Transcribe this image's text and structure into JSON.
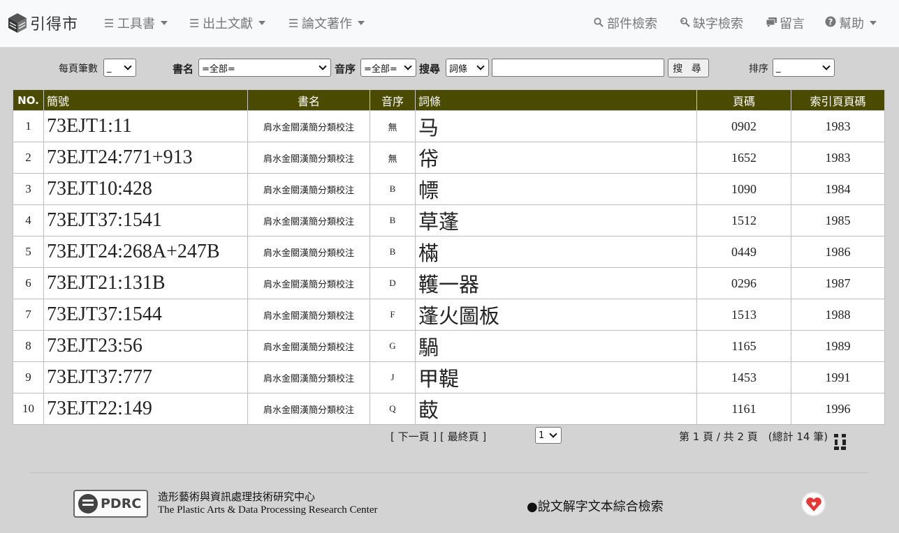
{
  "navbar": {
    "brand": "引得市",
    "menus": [
      {
        "label": "工具書"
      },
      {
        "label": "出土文獻"
      },
      {
        "label": "論文著作"
      }
    ],
    "links": [
      {
        "label": "部件檢索",
        "icon": "search-icon"
      },
      {
        "label": "缺字檢索",
        "icon": "key-search-icon"
      },
      {
        "label": "留言",
        "icon": "comment-icon"
      },
      {
        "label": "幫助",
        "icon": "help-icon"
      }
    ]
  },
  "filters": {
    "per_page_label": "每頁筆數",
    "per_page_value": "_",
    "book_label": "書名",
    "book_value": "=全部=",
    "sound_label": "音序",
    "sound_value": "=全部=",
    "search_label": "搜尋",
    "search_field_value": "詞條",
    "search_input_value": "",
    "search_button": "搜 尋",
    "sort_label": "排序",
    "sort_value": "_"
  },
  "table": {
    "headers": {
      "no": "NO.",
      "code": "簡號",
      "book": "書名",
      "sound": "音序",
      "entry": "詞條",
      "page": "頁碼",
      "index_page": "索引頁頁碼"
    },
    "rows": [
      {
        "no": "1",
        "code": "73EJT1:11",
        "book": "肩水金關漢簡分類校注",
        "sound": "無",
        "entry": "马",
        "page": "0902",
        "index_page": "1983"
      },
      {
        "no": "2",
        "code": "73EJT24:771+913",
        "book": "肩水金關漢簡分類校注",
        "sound": "無",
        "entry": "帒",
        "page": "1652",
        "index_page": "1983"
      },
      {
        "no": "3",
        "code": "73EJT10:428",
        "book": "肩水金關漢簡分類校注",
        "sound": "B",
        "entry": "幖",
        "page": "1090",
        "index_page": "1984"
      },
      {
        "no": "4",
        "code": "73EJT37:1541",
        "book": "肩水金關漢簡分類校注",
        "sound": "B",
        "entry": "草蓬",
        "page": "1512",
        "index_page": "1985"
      },
      {
        "no": "5",
        "code": "73EJT24:268A+247B",
        "book": "肩水金關漢簡分類校注",
        "sound": "B",
        "entry": "樠",
        "page": "0449",
        "index_page": "1986"
      },
      {
        "no": "6",
        "code": "73EJT21:131B",
        "book": "肩水金關漢簡分類校注",
        "sound": "D",
        "entry": "韄一器",
        "page": "0296",
        "index_page": "1987"
      },
      {
        "no": "7",
        "code": "73EJT37:1544",
        "book": "肩水金關漢簡分類校注",
        "sound": "F",
        "entry": "蓬火圖板",
        "page": "1513",
        "index_page": "1988"
      },
      {
        "no": "8",
        "code": "73EJT23:56",
        "book": "肩水金關漢簡分類校注",
        "sound": "G",
        "entry": "騧",
        "page": "1165",
        "index_page": "1989"
      },
      {
        "no": "9",
        "code": "73EJT37:777",
        "book": "肩水金關漢簡分類校注",
        "sound": "J",
        "entry": "甲鞮",
        "page": "1453",
        "index_page": "1991"
      },
      {
        "no": "10",
        "code": "73EJT22:149",
        "book": "肩水金關漢簡分類校注",
        "sound": "Q",
        "entry": "菣",
        "page": "1161",
        "index_page": "1996"
      }
    ]
  },
  "pagination": {
    "next": "[ 下一頁 ]",
    "last": "[ 最終頁 ]",
    "page_select": "1",
    "summary": "第 1 頁 / 共 2 頁　(總計 14 筆)"
  },
  "footer": {
    "logo_text": "PDRC",
    "org_zh": "造形藝術與資訊處理技術研究中心",
    "org_en": "The Plastic Arts & Data Processing Research Center",
    "link": "●說文解字文本綜合檢索"
  }
}
